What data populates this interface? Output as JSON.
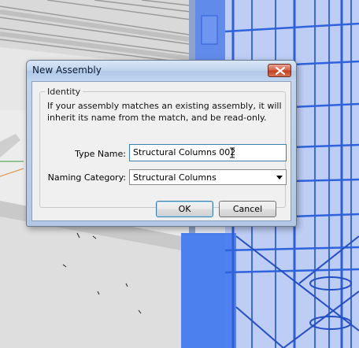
{
  "dialog": {
    "title": "New Assembly",
    "group_label": "Identity",
    "info_text": "If your assembly matches an existing assembly, it will inherit its name from the match, and be read-only.",
    "type_name_label": "Type Name:",
    "type_name_value": "Structural Columns 002",
    "naming_category_label": "Naming Category:",
    "naming_category_value": "Structural Columns",
    "ok_label": "OK",
    "cancel_label": "Cancel"
  },
  "icons": {
    "close": "close-icon",
    "dropdown": "chevron-down-icon",
    "cursor": "text-cursor-icon"
  },
  "colors": {
    "steel_blue": "#3d6fe0",
    "dialog_frame": "#b8cde8",
    "close_red": "#c94a2c"
  }
}
